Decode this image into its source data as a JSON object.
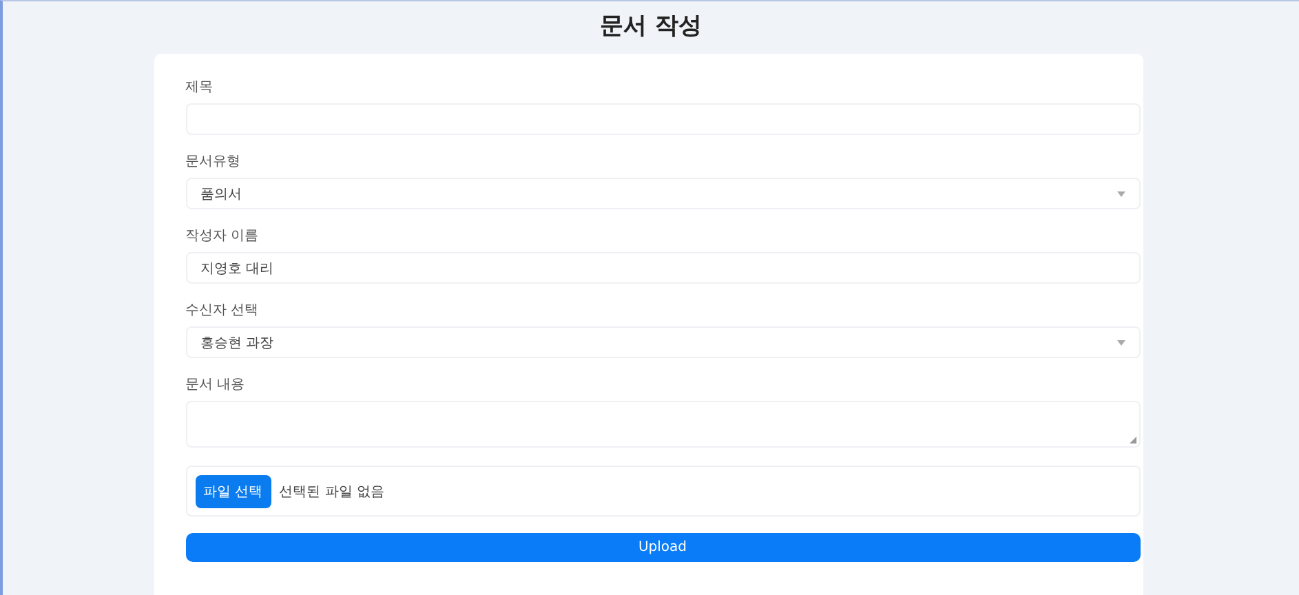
{
  "title": "문서 작성",
  "fields": [
    {
      "kind": "input",
      "label": "제목"
    },
    {
      "kind": "select",
      "label": "문서유형",
      "value": "품의서"
    },
    {
      "kind": "input",
      "label": "작성자 이름",
      "value": "지영호 대리"
    },
    {
      "kind": "select",
      "label": "수신자 선택",
      "value": "홍승현 과장"
    },
    {
      "kind": "textarea",
      "label": "문서 내용"
    }
  ],
  "file": {
    "button": "파일 선택",
    "status": "선택된 파일 없음"
  },
  "submit": "Upload"
}
